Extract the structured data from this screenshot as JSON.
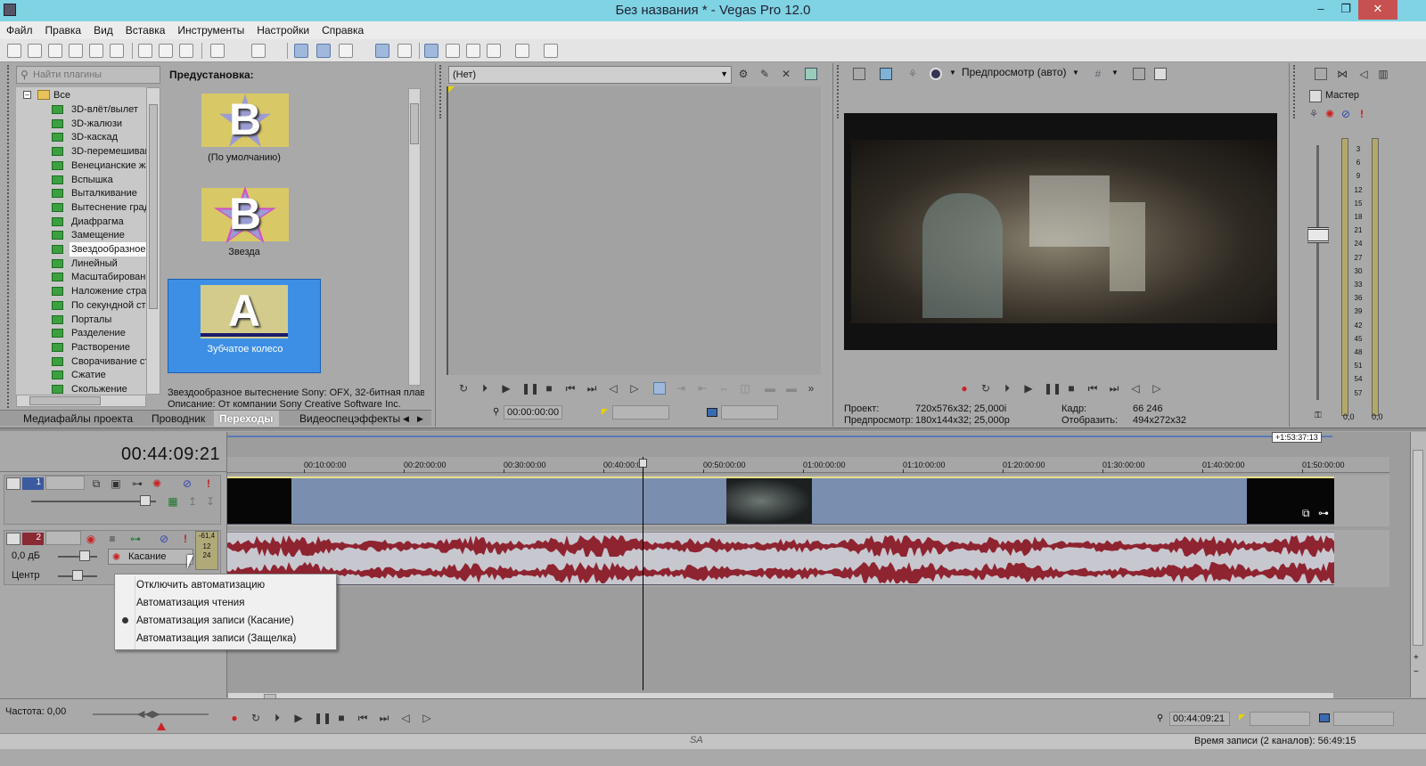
{
  "window": {
    "title": "Без названия * - Vegas Pro 12.0",
    "min_label": "–",
    "max_label": "❐",
    "close_label": "✕"
  },
  "menu": [
    "Файл",
    "Правка",
    "Вид",
    "Вставка",
    "Инструменты",
    "Настройки",
    "Справка"
  ],
  "plugins": {
    "search_placeholder": "Найти плагины",
    "root": "Все",
    "items": [
      "3D-влёт/вылет",
      "3D-жалюзи",
      "3D-каскад",
      "3D-перемешиван",
      "Венецианские жа",
      "Вспышка",
      "Выталкивание",
      "Вытеснение град",
      "Диафрагма",
      "Замещение",
      "Звездообразное",
      "Линейный",
      "Масштабировани",
      "Наложение стра",
      "По секундной ст",
      "Порталы",
      "Разделение",
      "Растворение",
      "Сворачивание ст",
      "Сжатие",
      "Скольжение"
    ],
    "selected_index": 10
  },
  "presets": {
    "header": "Предустановка:",
    "items": [
      {
        "letter": "B",
        "label": "(По умолчанию)"
      },
      {
        "letter": "B",
        "label": "Звезда"
      },
      {
        "letter": "A",
        "label": "Зубчатое колесо"
      }
    ],
    "description_line1": "Звездообразное вытеснение Sony: OFX, 32-битная плав",
    "description_line2": "Описание: От компании Sony Creative Software Inc."
  },
  "bottom_tabs": [
    "Медиафайлы проекта",
    "Проводник",
    "Переходы",
    "Видеоспецэффекты"
  ],
  "active_tab": "Переходы",
  "trimmer": {
    "dropdown_value": "(Нет)",
    "timecode": "00:00:00:00"
  },
  "preview": {
    "mode_label": "Предпросмотр (авто)",
    "project_label": "Проект:",
    "project_value": "720x576x32; 25,000i",
    "preview_label": "Предпросмотр:",
    "preview_value": "180x144x32; 25,000p",
    "frame_label": "Кадр:",
    "frame_value": "66 246",
    "display_label": "Отобразить:",
    "display_value": "494x272x32"
  },
  "master": {
    "label": "Мастер",
    "scale": [
      "3",
      "6",
      "9",
      "12",
      "15",
      "18",
      "21",
      "24",
      "27",
      "30",
      "33",
      "36",
      "39",
      "42",
      "45",
      "48",
      "51",
      "54",
      "57"
    ],
    "left_value": "0,0",
    "right_value": "0,0"
  },
  "timeline": {
    "current_time": "00:44:09:21",
    "end_marker": "+1:53:37:13",
    "ruler": [
      "00:10:00:00",
      "00:20:00:00",
      "00:30:00:00",
      "00:40:00:00",
      "00:50:00:00",
      "01:00:00:00",
      "01:10:00:00",
      "01:20:00:00",
      "01:30:00:00",
      "01:40:00:00",
      "01:50:00:00"
    ],
    "playhead_fraction": 0.375
  },
  "tracks": {
    "video": {
      "number": "1"
    },
    "audio": {
      "number": "2",
      "volume": "0,0 дБ",
      "pan": "Центр",
      "peak": "-61,4",
      "automation_mode": "Касание",
      "meter_a": "12",
      "meter_b": "24"
    }
  },
  "automation_menu": {
    "items": [
      "Отключить автоматизацию",
      "Автоматизация чтения",
      "Автоматизация записи (Касание)",
      "Автоматизация записи (Защелка)"
    ],
    "checked_index": 2
  },
  "bottom": {
    "rate": "Частота: 0,00",
    "timecode": "00:44:09:21",
    "status": "Время записи (2 каналов): 56:49:15"
  },
  "colors": {
    "titlebar": "#7fd3e3",
    "selection": "#3d8fe6",
    "video_event": "#7a8fb0",
    "audio_wave": "#8e2430",
    "audio_bg": "#c7c7cf"
  }
}
